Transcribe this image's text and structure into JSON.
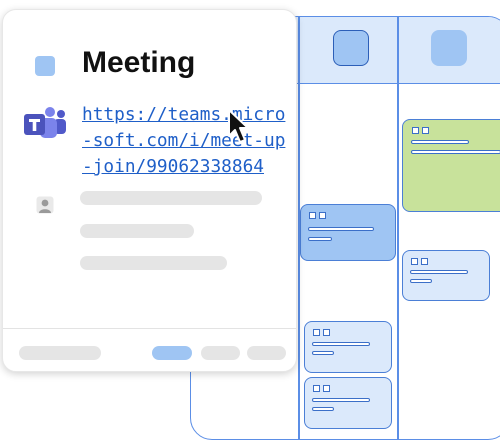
{
  "meeting": {
    "title": "Meeting",
    "link": "https://teams.micro-soft.com/i/meet-up-join/99062338864"
  },
  "icons": {
    "calendar_square": "calendar-color-icon",
    "teams": "microsoft-teams-icon",
    "attendee": "person-icon",
    "cursor": "mouse-pointer-icon"
  },
  "colors": {
    "accent_blue": "#9fc5f3",
    "light_blue": "#dbe9fb",
    "border_blue": "#4b7fd6",
    "event_green": "#c8e29b",
    "link_blue": "#1f5fc8"
  }
}
